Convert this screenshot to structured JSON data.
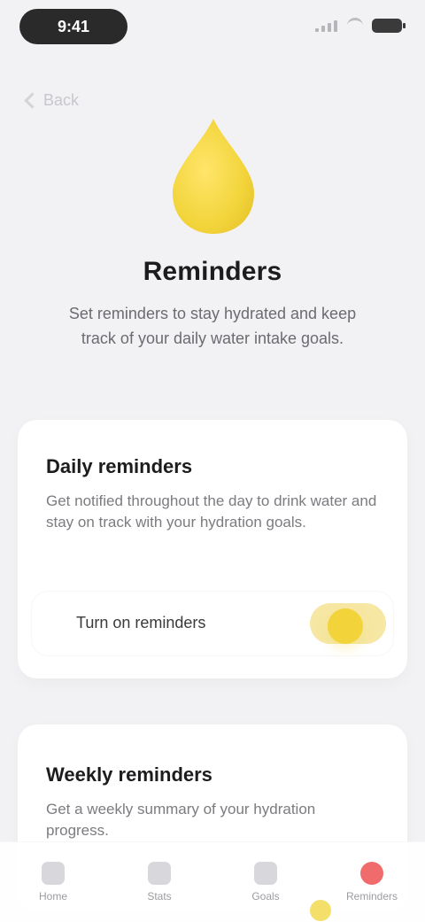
{
  "status_bar": {
    "time": "9:41"
  },
  "nav": {
    "back_label": "Back"
  },
  "hero": {
    "icon": "water-drop-icon",
    "title": "Reminders",
    "description": "Set reminders to stay hydrated and keep track of your daily water intake goals."
  },
  "cards": {
    "daily": {
      "title": "Daily reminders",
      "description": "Get notified throughout the day to drink water and stay on track with your hydration goals.",
      "row_label": "Turn on reminders",
      "toggle_on": true
    },
    "weekly": {
      "title": "Weekly reminders",
      "description": "Get a weekly summary of your hydration progress."
    }
  },
  "tabs": [
    {
      "label": "Home",
      "icon": "home-icon"
    },
    {
      "label": "Stats",
      "icon": "chart-icon"
    },
    {
      "label": "Goals",
      "icon": "target-icon"
    },
    {
      "label": "Reminders",
      "icon": "bell-icon"
    }
  ],
  "colors": {
    "accent": "#f2d43a",
    "background": "#f2f2f5",
    "danger": "#f06c6c"
  }
}
